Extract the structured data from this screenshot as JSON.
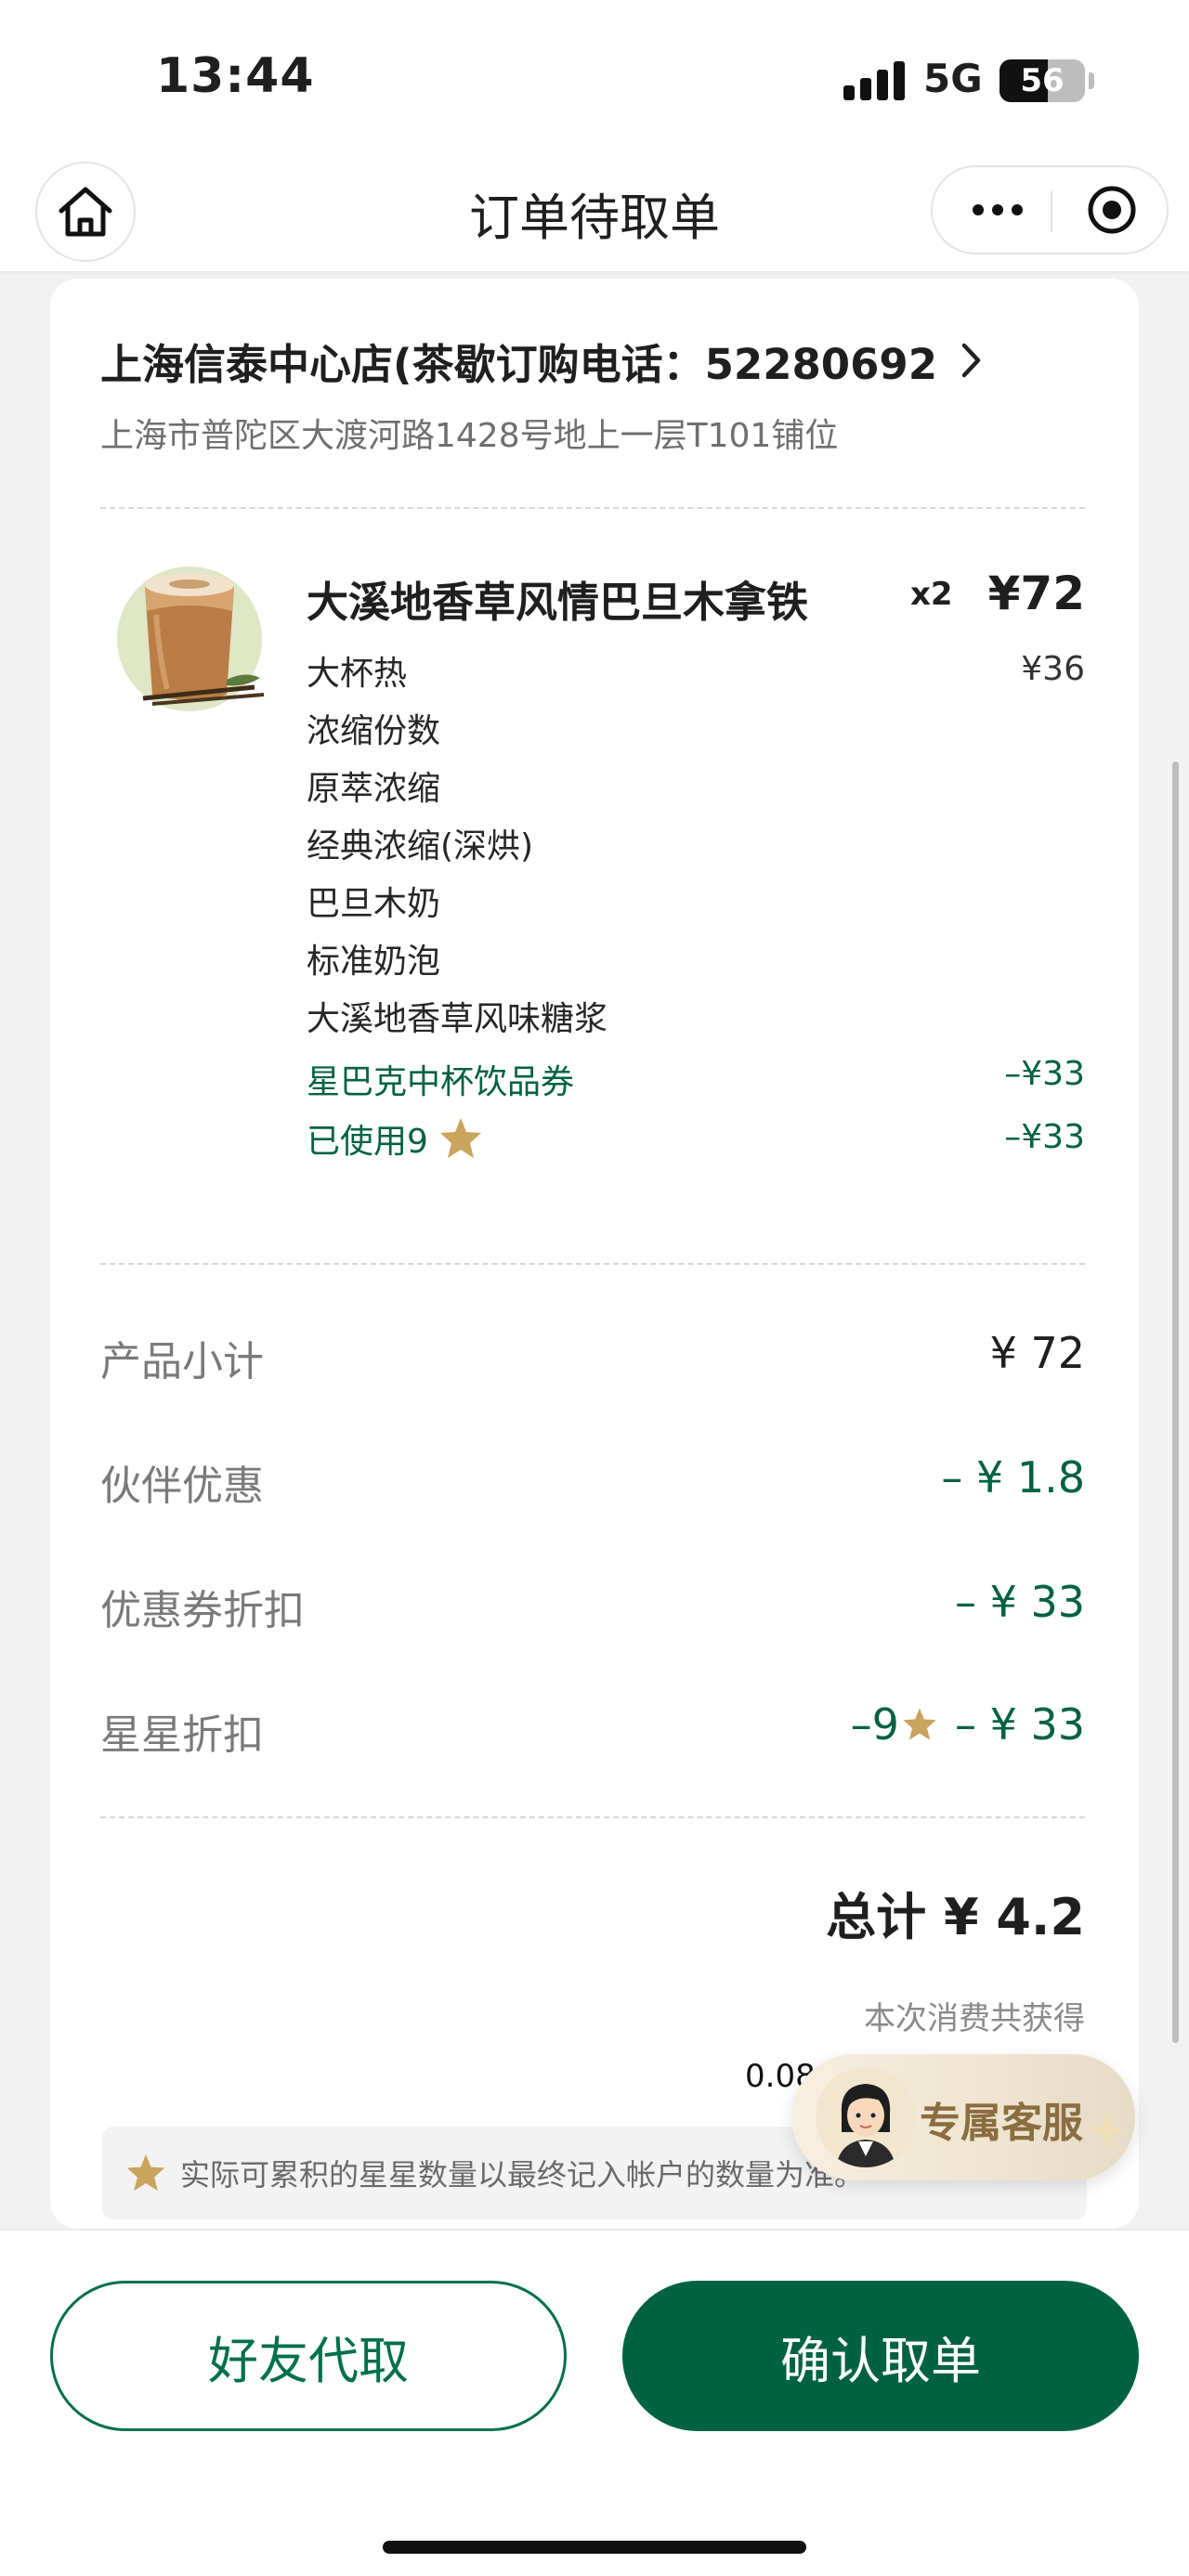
{
  "status_bar": {
    "time": "13:44",
    "network": "5G",
    "battery_percent": "56",
    "icons": [
      "signal-icon",
      "battery-icon"
    ]
  },
  "nav": {
    "title": "订单待取单",
    "icons": [
      "home-icon",
      "more-icon",
      "target-icon"
    ]
  },
  "store": {
    "name": "上海信泰中心店(茶歇订购电话：52280692",
    "address": "上海市普陀区大渡河路1428号地上一层T101铺位"
  },
  "product": {
    "name": "大溪地香草风情巴旦木拿铁",
    "quantity": "x2",
    "price": "¥72",
    "unit_price": "¥36",
    "options": [
      "大杯热",
      "浓缩份数",
      "原萃浓缩",
      "经典浓缩(深烘)",
      "巴旦木奶",
      "标准奶泡",
      "大溪地香草风味糖浆"
    ],
    "coupon_label": "星巴克中杯饮品券",
    "coupon_value": "–¥33",
    "stars_used_label": "已使用9",
    "stars_used_value": "–¥33"
  },
  "summary": {
    "subtotal_label": "产品小计",
    "subtotal_value": "¥ 72",
    "partner_label": "伙伴优惠",
    "partner_value": "– ¥ 1.8",
    "coupon_label": "优惠券折扣",
    "coupon_value": "– ¥ 33",
    "star_label": "星星折扣",
    "star_count": "–9",
    "star_value": "– ¥ 33",
    "total": "总计 ¥ 4.2",
    "earn_text": "本次消费共获得",
    "earn_value": "0.08",
    "notice": "实际可累积的星星数量以最终记入帐户的数量为准。"
  },
  "service": {
    "label": "专属客服"
  },
  "actions": {
    "friend_pickup": "好友代取",
    "confirm_pickup": "确认取单"
  },
  "colors": {
    "brand_green": "#006241",
    "star_gold": "#c9a45c",
    "text_gray": "#7a7a7a"
  }
}
